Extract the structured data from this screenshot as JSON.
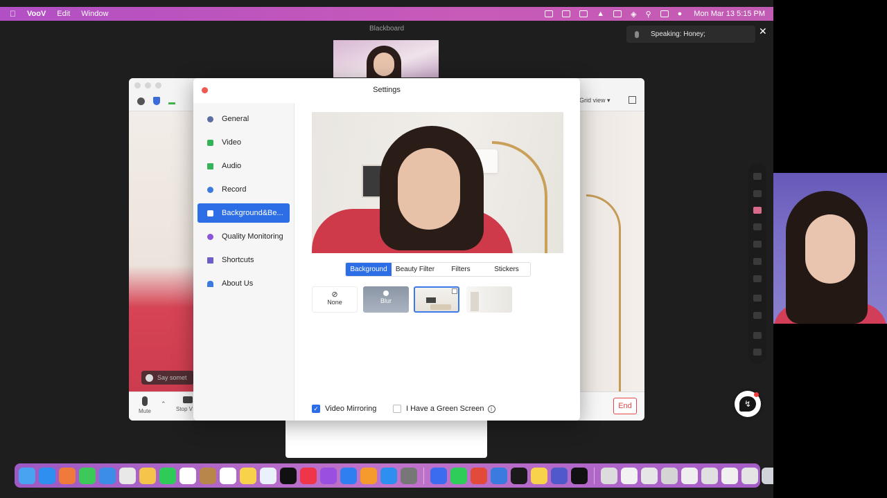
{
  "menubar": {
    "app_name": "VooV",
    "menus": [
      "Edit",
      "Window"
    ],
    "clock": "Mon Mar 13  5:15 PM"
  },
  "blackboard": {
    "title": "Blackboard",
    "speaking": "Speaking: Honey;"
  },
  "meeting": {
    "grid_view": "Grid view",
    "say_something": "Say somet",
    "mute_label": "Mute",
    "stop_video_label": "Stop V",
    "end_label": "End"
  },
  "settings": {
    "title": "Settings",
    "nav": [
      {
        "label": "General",
        "icon": "gear-icon",
        "color": "#5a6ea0"
      },
      {
        "label": "Video",
        "icon": "video-icon",
        "color": "#35b35a"
      },
      {
        "label": "Audio",
        "icon": "audio-icon",
        "color": "#35b35a"
      },
      {
        "label": "Record",
        "icon": "record-icon",
        "color": "#3b7be0"
      },
      {
        "label": "Background&Be...",
        "icon": "background-icon",
        "color": "#ffffff"
      },
      {
        "label": "Quality Monitoring",
        "icon": "quality-icon",
        "color": "#8a55d6"
      },
      {
        "label": "Shortcuts",
        "icon": "keyboard-icon",
        "color": "#6a5fc9"
      },
      {
        "label": "About Us",
        "icon": "about-icon",
        "color": "#3b7be0"
      }
    ],
    "active_nav": "Background&Be...",
    "tabs": [
      "Background",
      "Beauty Filter",
      "Filters",
      "Stickers"
    ],
    "active_tab": "Background",
    "bg_options": {
      "none": "None",
      "blur": "Blur"
    },
    "video_mirroring": {
      "label": "Video Mirroring",
      "checked": true
    },
    "green_screen": {
      "label": "I Have a Green Screen",
      "checked": false
    },
    "accent_color": "#2d6ee6"
  }
}
